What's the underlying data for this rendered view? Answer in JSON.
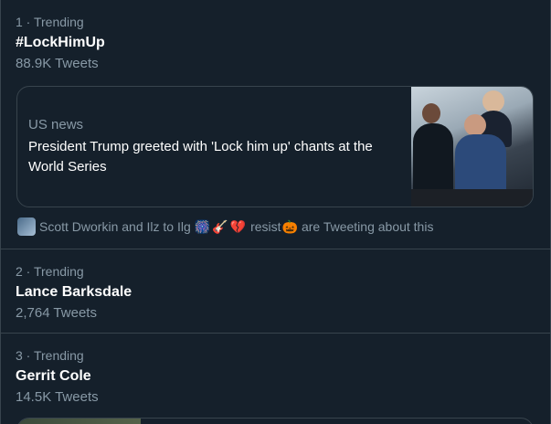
{
  "trends": [
    {
      "meta": "1 · Trending",
      "name": "#LockHimUp",
      "count": "88.9K Tweets",
      "card": {
        "source": "US news",
        "headline": "President Trump greeted with 'Lock him up' chants at the World Series"
      },
      "social": {
        "text_before": "Scott Dworkin and Ilz to Ilg",
        "emojis": [
          "🎆",
          "🎸",
          "💔"
        ],
        "resist_label": "resist",
        "resist_emoji": "🎃",
        "text_after": "are Tweeting about this"
      }
    },
    {
      "meta": "2 · Trending",
      "name": "Lance Barksdale",
      "count": "2,764 Tweets"
    },
    {
      "meta": "3 · Trending",
      "name": "Gerrit Cole",
      "count": "14.5K Tweets"
    }
  ],
  "colors": {
    "background": "#15202b",
    "border": "#38444d",
    "secondary_text": "#8899a6",
    "primary_text": "#ffffff"
  }
}
